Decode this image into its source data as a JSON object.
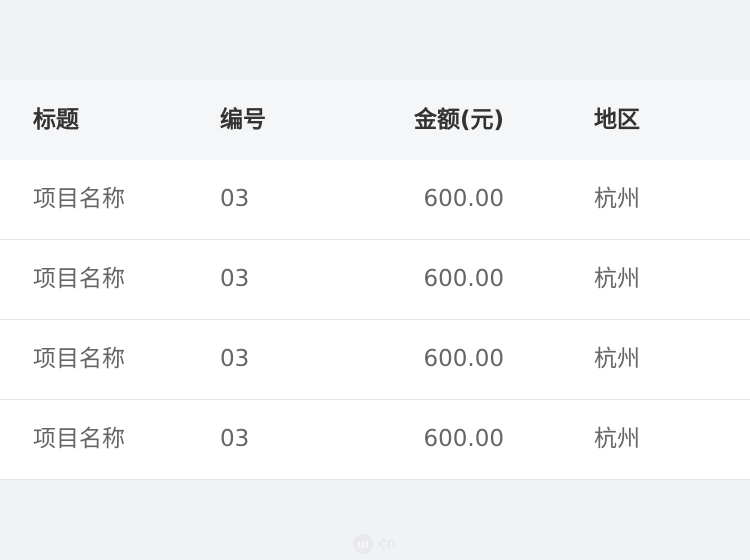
{
  "table": {
    "headers": {
      "title": "标题",
      "code": "编号",
      "amount": "金额(元)",
      "region": "地区"
    },
    "rows": [
      {
        "title": "项目名称",
        "code": "03",
        "amount": "600.00",
        "region": "杭州"
      },
      {
        "title": "项目名称",
        "code": "03",
        "amount": "600.00",
        "region": "杭州"
      },
      {
        "title": "项目名称",
        "code": "03",
        "amount": "600.00",
        "region": "杭州"
      },
      {
        "title": "项目名称",
        "code": "03",
        "amount": "600.00",
        "region": "杭州"
      }
    ]
  },
  "watermark": {
    "icon_text": "ui",
    "text": "cn"
  },
  "colors": {
    "page_bg": "#f1f2f4",
    "header_bg": "#f5f6f8",
    "row_bg": "#ffffff",
    "header_text": "#333333",
    "body_text": "#666666",
    "divider": "#e6e6e6"
  }
}
